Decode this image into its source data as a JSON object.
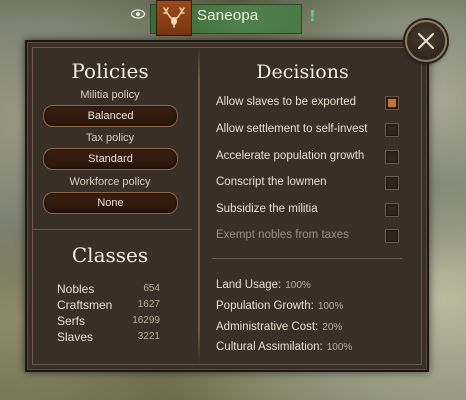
{
  "header": {
    "town_name": "Saneopa",
    "alert_glyph": "!"
  },
  "policies": {
    "title": "Policies",
    "items": [
      {
        "label": "Militia policy",
        "value": "Balanced"
      },
      {
        "label": "Tax policy",
        "value": "Standard"
      },
      {
        "label": "Workforce policy",
        "value": "None"
      }
    ]
  },
  "classes": {
    "title": "Classes",
    "rows": [
      {
        "name": "Nobles",
        "count": "654"
      },
      {
        "name": "Craftsmen",
        "count": "1627"
      },
      {
        "name": "Serfs",
        "count": "16299"
      },
      {
        "name": "Slaves",
        "count": "3221"
      }
    ]
  },
  "decisions": {
    "title": "Decisions",
    "items": [
      {
        "label": "Allow slaves to be exported",
        "checked": true,
        "enabled": true
      },
      {
        "label": "Allow settlement to self-invest",
        "checked": false,
        "enabled": true
      },
      {
        "label": "Accelerate population growth",
        "checked": false,
        "enabled": true
      },
      {
        "label": "Conscript the lowmen",
        "checked": false,
        "enabled": true
      },
      {
        "label": "Subsidize the militia",
        "checked": false,
        "enabled": true
      },
      {
        "label": "Exempt nobles from taxes",
        "checked": false,
        "enabled": false
      }
    ]
  },
  "stats": [
    {
      "label": "Land Usage:",
      "value": "100%"
    },
    {
      "label": "Population Growth:",
      "value": "100%"
    },
    {
      "label": "Administrative Cost:",
      "value": "20%"
    },
    {
      "label": "Cultural Assimilation:",
      "value": "100%"
    }
  ],
  "icons": {
    "visibility": "eye-icon",
    "banner": "stag-icon",
    "alert": "exclamation-icon",
    "close": "close-icon"
  },
  "colors": {
    "panel_bg": "#3a2f26",
    "checkbox_checked": "#c8703a",
    "banner": "#9a4a1a",
    "nameplate": "#4f7f4b",
    "alert": "#5ad27a"
  }
}
